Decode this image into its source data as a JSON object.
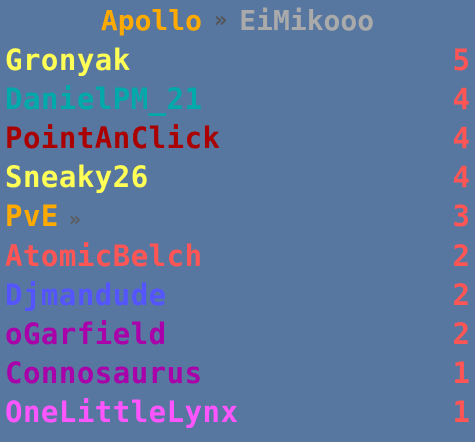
{
  "title": {
    "part1": "Apollo",
    "part1_color": "#ffaa00",
    "separator": "»",
    "separator_color": "#555555",
    "part2": "EiMikooo",
    "part2_color": "#aaaaaa"
  },
  "score_color": "#ff5555",
  "rows": [
    {
      "name": "Gronyak",
      "color": "#ffff55",
      "suffix": "",
      "score": "5"
    },
    {
      "name": "DanielPM_21",
      "color": "#00aaaa",
      "suffix": "",
      "score": "4"
    },
    {
      "name": "PointAnClick",
      "color": "#aa0000",
      "suffix": "",
      "score": "4"
    },
    {
      "name": "Sneaky26",
      "color": "#ffff55",
      "suffix": "",
      "score": "4"
    },
    {
      "name": "PvE",
      "color": "#ffaa00",
      "suffix": "»",
      "score": "3"
    },
    {
      "name": "AtomicBelch",
      "color": "#ff5555",
      "suffix": "",
      "score": "2"
    },
    {
      "name": "Djmandude",
      "color": "#5555ff",
      "suffix": "",
      "score": "2"
    },
    {
      "name": "oGarfield",
      "color": "#aa00aa",
      "suffix": "",
      "score": "2"
    },
    {
      "name": "Connosaurus",
      "color": "#aa00aa",
      "suffix": "",
      "score": "1"
    },
    {
      "name": "OneLittleLynx",
      "color": "#ff55ff",
      "suffix": "",
      "score": "1"
    }
  ]
}
